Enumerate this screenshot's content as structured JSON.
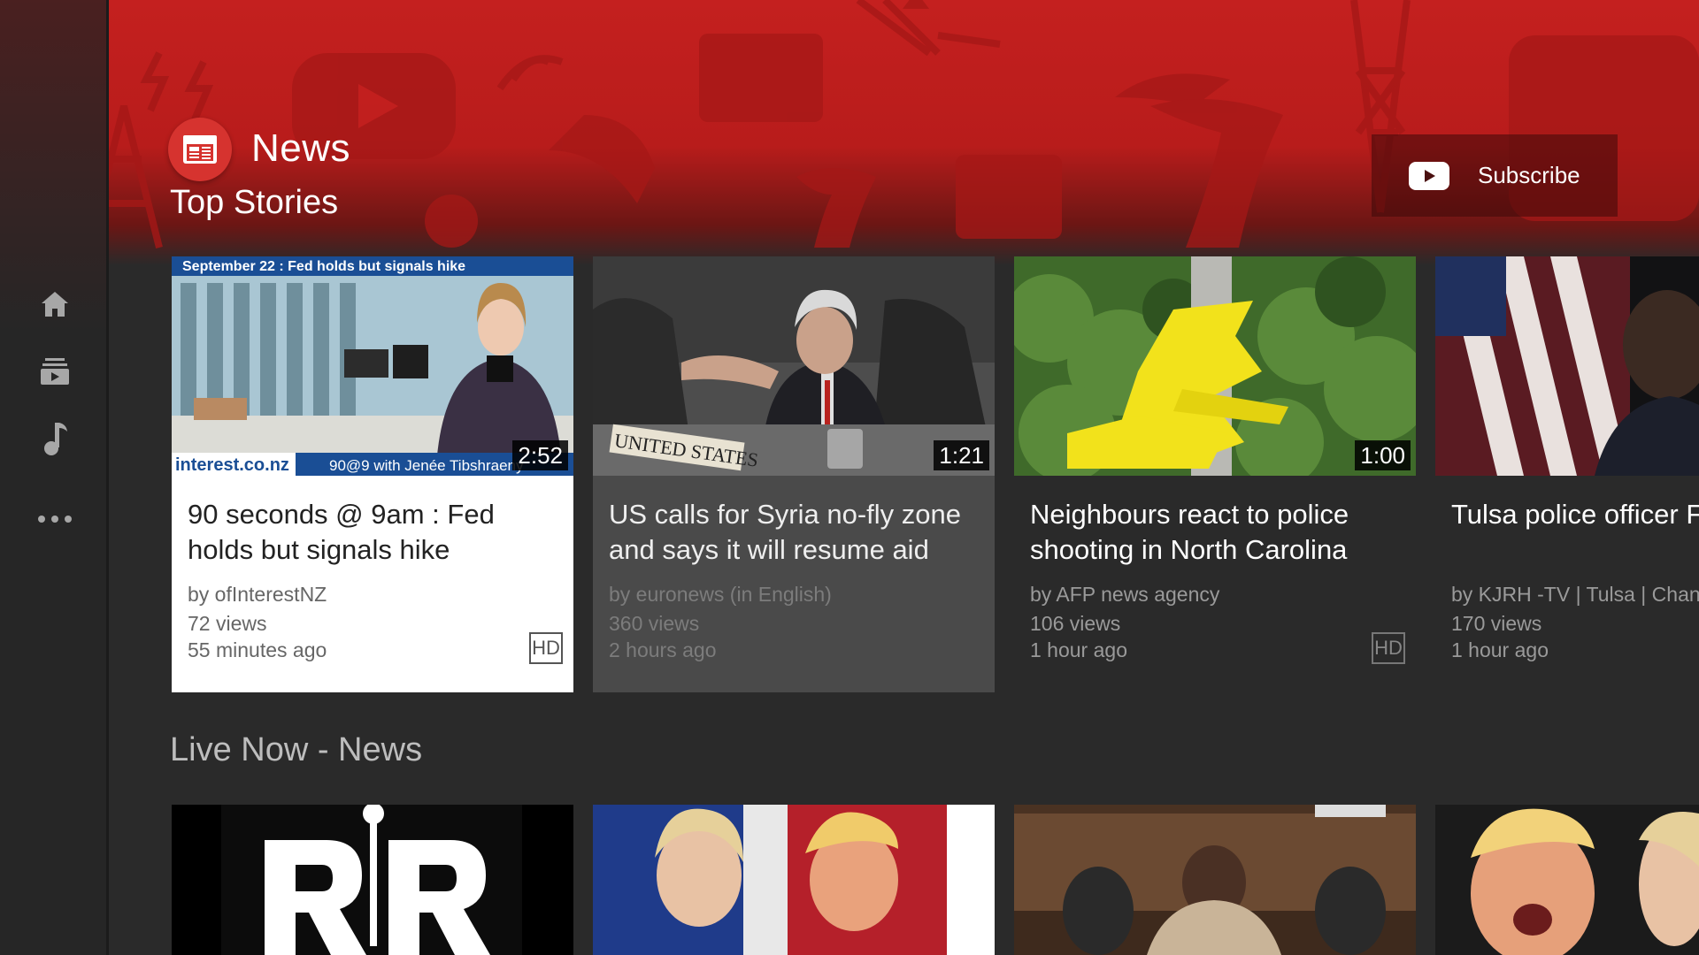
{
  "colors": {
    "banner_red": "#c4201f",
    "background": "#2a2a2a",
    "channel_icon_red": "#d6332f",
    "selected_card": "#ffffff"
  },
  "nav": {
    "items": [
      {
        "name": "home",
        "icon": "home-icon"
      },
      {
        "name": "subscriptions",
        "icon": "subscriptions-icon"
      },
      {
        "name": "music",
        "icon": "music-note-icon"
      },
      {
        "name": "more",
        "icon": "more-horizontal-icon"
      }
    ]
  },
  "header": {
    "channel_name": "News",
    "channel_icon": "newspaper-icon",
    "shelf_title": "Top Stories",
    "subscribe_label": "Subscribe",
    "subscribe_icon": "youtube-play-icon"
  },
  "top_stories": [
    {
      "title": "90 seconds @ 9am : Fed holds but signals hike",
      "channel": "by ofInterestNZ",
      "views": "72 views",
      "age": "55 minutes ago",
      "duration": "2:52",
      "hd": "HD",
      "thumb_banner": "September 22 : Fed holds but signals hike",
      "thumb_brand": "interest.co.nz",
      "thumb_lower_third": "90@9 with Jenée Tibshraeny"
    },
    {
      "title": "US calls for Syria no-fly zone and says it will resume aid",
      "channel": "by euronews (in English)",
      "views": "360 views",
      "age": "2 hours ago",
      "duration": "1:21",
      "thumb_placard": "UNITED STATES"
    },
    {
      "title": "Neighbours react to police shooting in North Carolina",
      "channel": "by AFP news agency",
      "views": "106 views",
      "age": "1 hour ago",
      "duration": "1:00",
      "hd": "HD"
    },
    {
      "title": "Tulsa police officer Floyd talks about Fa",
      "channel": "by KJRH -TV | Tulsa | Chan",
      "views": "170 views",
      "age": "1 hour ago"
    }
  ],
  "live_section": {
    "title": "Live Now - News"
  }
}
